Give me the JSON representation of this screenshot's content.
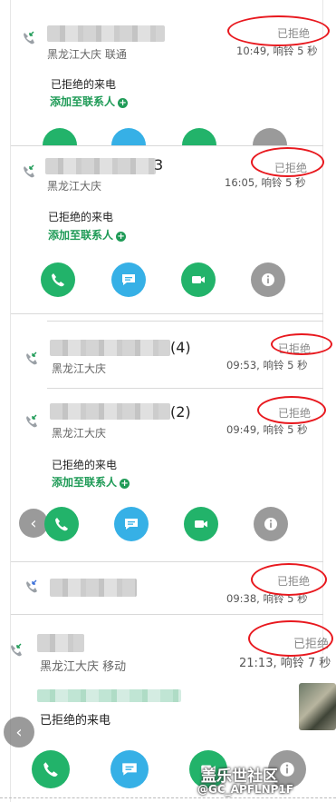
{
  "calls": [
    {
      "name_suffix": "",
      "location": "黑龙江大庆 联通",
      "status": "已拒绝",
      "time": "10:49, 响铃 5 秒",
      "expanded": true,
      "reject_label": "已拒绝的来电",
      "add_contact_label": "添加至联系人"
    },
    {
      "name_suffix": "3",
      "location": "黑龙江大庆",
      "status": "已拒绝",
      "time": "16:05, 响铃 5 秒",
      "expanded": true,
      "reject_label": "已拒绝的来电",
      "add_contact_label": "添加至联系人"
    },
    {
      "name_suffix": "(4)",
      "location": "黑龙江大庆",
      "status": "已拒绝",
      "time": "09:53, 响铃 5 秒",
      "expanded": false
    },
    {
      "name_suffix": "(2)",
      "location": "黑龙江大庆",
      "status": "已拒绝",
      "time": "09:49, 响铃 5 秒",
      "expanded": true,
      "reject_label": "已拒绝的来电",
      "add_contact_label": "添加至联系人"
    },
    {
      "name_suffix": "",
      "location": "",
      "status": "已拒绝",
      "time": "09:38, 响铃 5 秒",
      "expanded": false
    },
    {
      "name_suffix": "",
      "location": "黑龙江大庆 移动",
      "status": "已拒绝",
      "time": "21:13, 响铃 7 秒",
      "expanded": true,
      "reject_label": "已拒绝的来电"
    }
  ],
  "actions": [
    "call",
    "message",
    "video",
    "info"
  ],
  "icons": {
    "call": "phone-icon",
    "message": "message-icon",
    "video": "video-icon",
    "info": "info-icon",
    "incoming": "incoming-call-icon",
    "back": "back-chevron-icon"
  },
  "colors": {
    "green": "#22b36a",
    "blue": "#36b0e6",
    "grey": "#9a9a9a",
    "link": "#1f9b57",
    "annotation": "#e8181e"
  },
  "watermark": {
    "line1": "盖乐世社区",
    "line2": "@GC_APFLNP1F"
  }
}
